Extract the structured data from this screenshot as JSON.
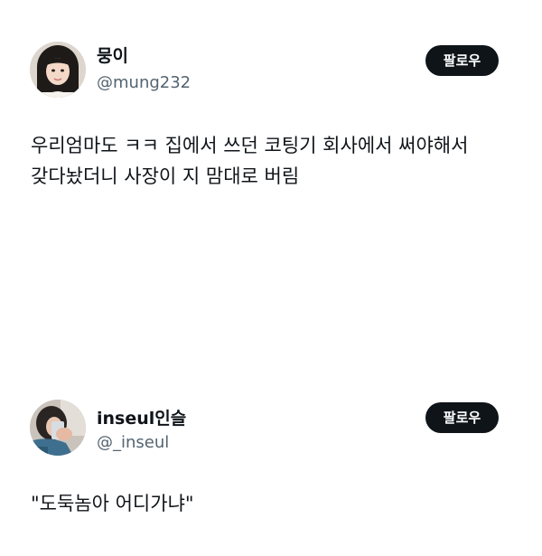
{
  "posts": [
    {
      "display_name": "뭉이",
      "handle": "@mung232",
      "follow_label": "팔로우",
      "text_lines": [
        "우리엄마도 ㅋㅋ 집에서 쓰던 코팅기 회사에서 써야해서",
        "갖다놨더니 사장이 지 맘대로 버림"
      ]
    },
    {
      "display_name": "inseul인슬",
      "handle": "@_inseul",
      "follow_label": "팔로우",
      "text_lines": [
        "\"도둑놈아 어디가냐\""
      ]
    }
  ]
}
